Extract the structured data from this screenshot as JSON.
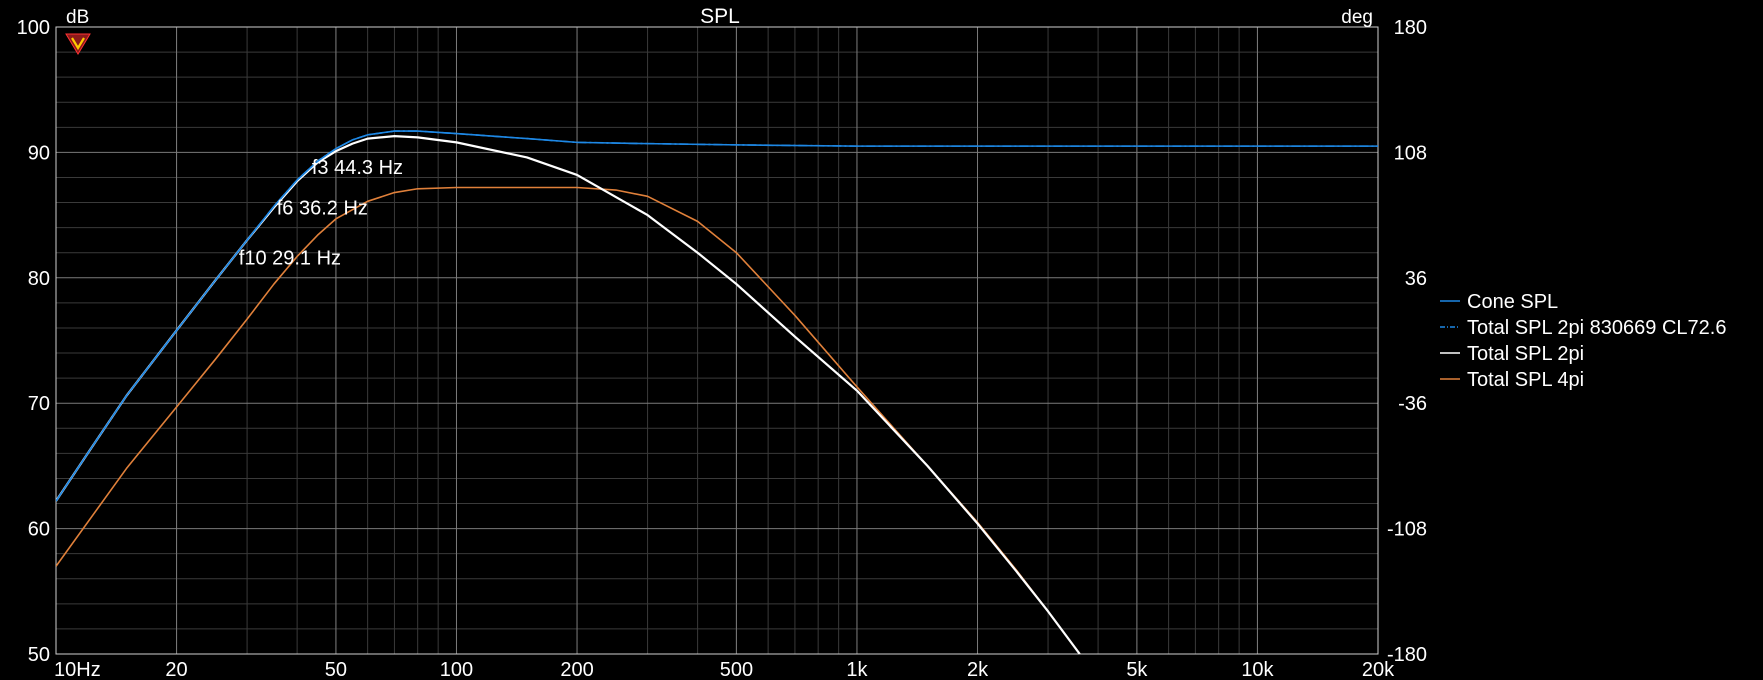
{
  "chart_data": {
    "type": "line",
    "title": "SPL",
    "y_left_unit": "dB",
    "y_right_unit": "deg",
    "x_scale": "log",
    "xlim": [
      10,
      20000
    ],
    "ylim_left": [
      50,
      100
    ],
    "ylim_right": [
      -180,
      180
    ],
    "grid": true,
    "legend_position": "right",
    "x_ticks": [
      {
        "value": 10,
        "label": "10Hz"
      },
      {
        "value": 20,
        "label": "20"
      },
      {
        "value": 50,
        "label": "50"
      },
      {
        "value": 100,
        "label": "100"
      },
      {
        "value": 200,
        "label": "200"
      },
      {
        "value": 500,
        "label": "500"
      },
      {
        "value": 1000,
        "label": "1k"
      },
      {
        "value": 2000,
        "label": "2k"
      },
      {
        "value": 5000,
        "label": "5k"
      },
      {
        "value": 10000,
        "label": "10k"
      },
      {
        "value": 20000,
        "label": "20k"
      }
    ],
    "y_left_ticks": [
      {
        "value": 50,
        "label": "50"
      },
      {
        "value": 60,
        "label": "60"
      },
      {
        "value": 70,
        "label": "70"
      },
      {
        "value": 80,
        "label": "80"
      },
      {
        "value": 90,
        "label": "90"
      },
      {
        "value": 100,
        "label": "100"
      }
    ],
    "y_right_ticks": [
      {
        "value": -180,
        "label": "-180"
      },
      {
        "value": -108,
        "label": "-108"
      },
      {
        "value": -36,
        "label": "-36"
      },
      {
        "value": 36,
        "label": "36"
      },
      {
        "value": 108,
        "label": "108"
      },
      {
        "value": 180,
        "label": "180"
      }
    ],
    "annotations": [
      {
        "text": "f3 44.3 Hz",
        "x": 44.3,
        "y": 88.9
      },
      {
        "text": "f6 36.2 Hz",
        "x": 36.2,
        "y": 85.7
      },
      {
        "text": "f10 29.1 Hz",
        "x": 29.1,
        "y": 81.7
      }
    ],
    "series": [
      {
        "name": "Cone SPL",
        "color": "#1e88e5",
        "dash": "solid",
        "x": [
          10,
          12,
          15,
          20,
          25,
          30,
          35,
          40,
          45,
          50,
          55,
          60,
          70,
          80,
          100,
          150,
          200,
          300,
          500,
          1000,
          2000,
          5000,
          10000,
          20000
        ],
        "y": [
          62.2,
          66.0,
          70.6,
          75.8,
          79.8,
          83.0,
          85.7,
          87.8,
          89.3,
          90.3,
          91.0,
          91.4,
          91.7,
          91.7,
          91.5,
          91.1,
          90.8,
          90.7,
          90.6,
          90.5,
          90.5,
          90.5,
          90.5,
          90.5
        ]
      },
      {
        "name": "Total SPL 2pi 830669 CL72.6",
        "color": "#1e88e5",
        "dash": "dashdot",
        "x": [
          10,
          12,
          15,
          20,
          25,
          30,
          35,
          40,
          45,
          50,
          55,
          60,
          70,
          80,
          100,
          150,
          200,
          300,
          500,
          1000,
          2000,
          5000,
          10000,
          20000
        ],
        "y": [
          62.2,
          66.0,
          70.6,
          75.8,
          79.8,
          83.0,
          85.7,
          87.8,
          89.3,
          90.3,
          91.0,
          91.4,
          91.7,
          91.7,
          91.5,
          91.1,
          90.8,
          90.7,
          90.6,
          90.5,
          90.5,
          90.5,
          90.5,
          90.5
        ]
      },
      {
        "name": "Total SPL 2pi",
        "color": "#ffffff",
        "dash": "solid",
        "x": [
          10,
          12,
          15,
          20,
          25,
          30,
          35,
          40,
          45,
          50,
          55,
          60,
          70,
          80,
          100,
          150,
          200,
          300,
          400,
          500,
          700,
          1000,
          1500,
          2000,
          2500,
          3000,
          3600
        ],
        "y": [
          62.2,
          66.0,
          70.6,
          75.8,
          79.8,
          83.0,
          85.6,
          87.7,
          89.2,
          90.1,
          90.7,
          91.1,
          91.3,
          91.2,
          90.8,
          89.6,
          88.2,
          85.0,
          82.0,
          79.5,
          75.3,
          71.0,
          65.0,
          60.4,
          56.6,
          53.4,
          50.0
        ]
      },
      {
        "name": "Total SPL 4pi",
        "color": "#e0803a",
        "dash": "solid",
        "x": [
          10,
          15,
          20,
          25,
          30,
          35,
          40,
          45,
          50,
          60,
          70,
          80,
          100,
          150,
          200,
          250,
          300,
          400,
          500,
          700,
          1000,
          1500,
          2000,
          2500,
          3000,
          3600
        ],
        "y": [
          57.0,
          64.8,
          69.7,
          73.5,
          76.7,
          79.5,
          81.7,
          83.4,
          84.7,
          86.1,
          86.8,
          87.1,
          87.2,
          87.2,
          87.2,
          87.0,
          86.5,
          84.5,
          82.0,
          77.0,
          71.3,
          65.0,
          60.5,
          56.7,
          53.4,
          50.0
        ]
      }
    ]
  }
}
